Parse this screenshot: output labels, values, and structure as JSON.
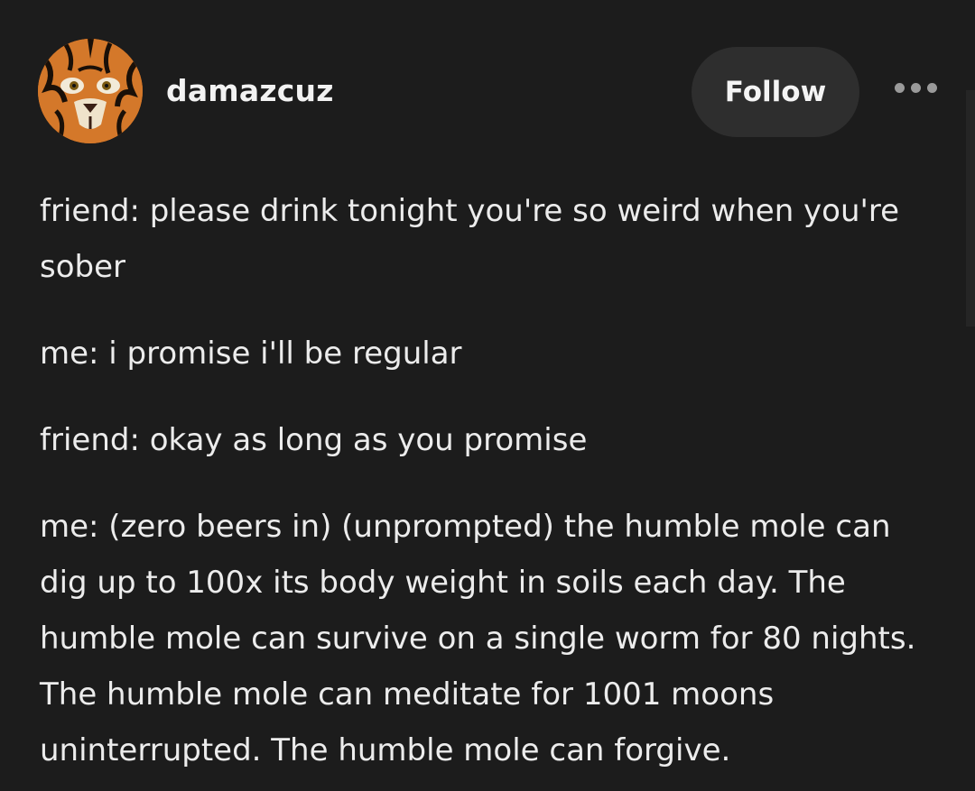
{
  "post": {
    "author": "damazcuz",
    "follow_label": "Follow",
    "more_icon": "ellipsis-icon",
    "avatar_icon": "tiger-avatar",
    "paragraphs": [
      "friend: please drink tonight you're so weird when you're sober",
      "me: i promise i'll be regular",
      "friend: okay as long as you promise",
      "me: (zero beers in) (unprompted) the humble mole can dig up to 100x its body weight in soils each day. The humble mole can survive on a single worm for 80 nights. The humble mole can meditate for 1001 moons uninterrupted. The humble mole can forgive."
    ]
  },
  "colors": {
    "background": "#1c1c1c",
    "button": "#2e2e2e",
    "text": "#ececec",
    "muted": "#9a9a9a"
  }
}
